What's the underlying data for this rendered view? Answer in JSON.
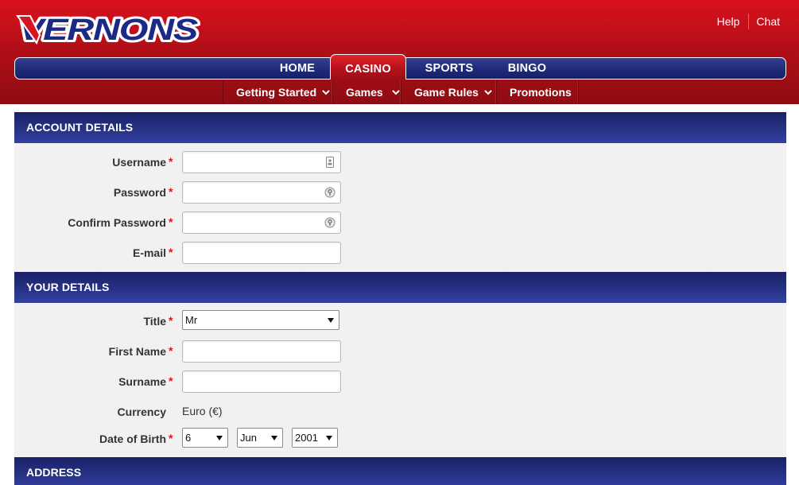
{
  "brand": {
    "name": "VERNONS",
    "primary_red": "#c7101a",
    "navy": "#1f2a78"
  },
  "top_links": {
    "help": "Help",
    "chat": "Chat"
  },
  "main_nav": {
    "items": [
      "HOME",
      "CASINO",
      "SPORTS",
      "BINGO"
    ],
    "active": "CASINO"
  },
  "sub_nav": {
    "items": [
      {
        "label": "Getting Started",
        "has_dropdown": true
      },
      {
        "label": "Games",
        "has_dropdown": true
      },
      {
        "label": "Game Rules",
        "has_dropdown": true
      },
      {
        "label": "Promotions",
        "has_dropdown": false
      }
    ]
  },
  "form": {
    "required_marker": "*",
    "account": {
      "heading": "ACCOUNT DETAILS",
      "username_label": "Username",
      "password_label": "Password",
      "confirm_password_label": "Confirm Password",
      "email_label": "E-mail"
    },
    "details": {
      "heading": "YOUR DETAILS",
      "title_label": "Title",
      "title_value": "Mr",
      "first_name_label": "First Name",
      "surname_label": "Surname",
      "currency_label": "Currency",
      "currency_value": "Euro (€)",
      "dob_label": "Date of Birth",
      "dob_day": "6",
      "dob_month": "Jun",
      "dob_year": "2001"
    },
    "address": {
      "heading": "ADDRESS"
    }
  }
}
